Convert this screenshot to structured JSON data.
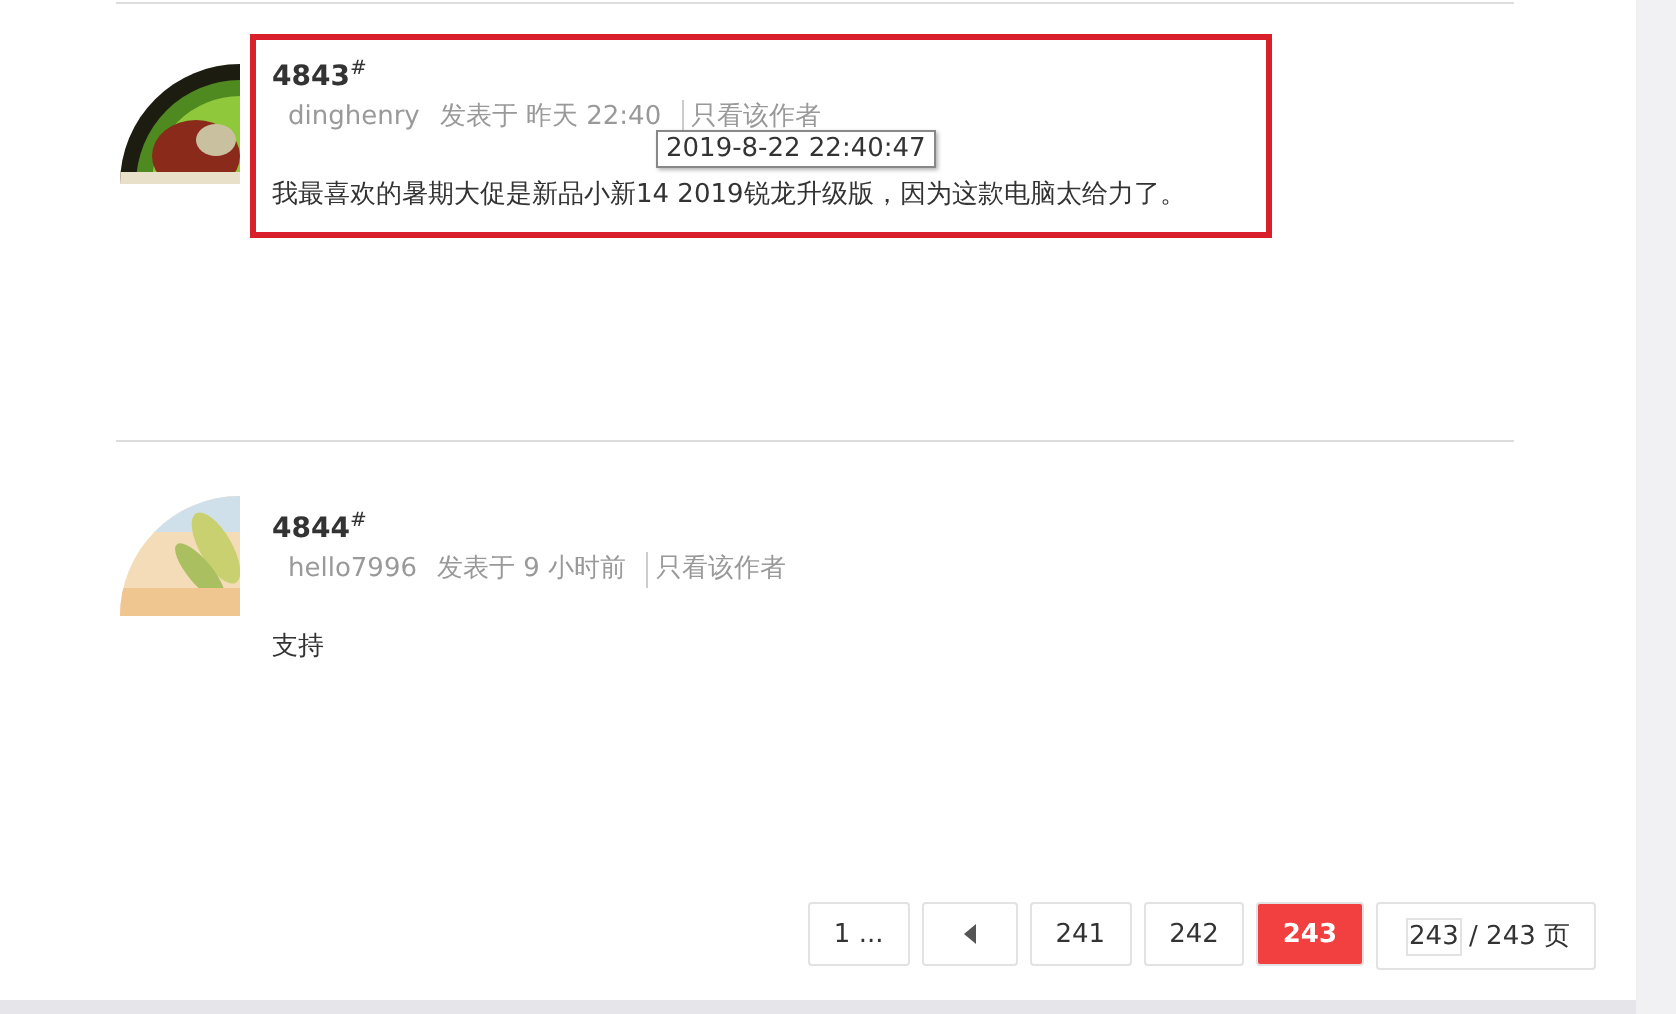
{
  "posts": [
    {
      "floor": "4843",
      "floor_mark": "#",
      "author": "dinghenry",
      "posted": "发表于 昨天 22:40",
      "author_only": "只看该作者",
      "body": "我最喜欢的暑期大促是新品小新14 2019锐龙升级版，因为这款电脑太给力了。",
      "highlighted": true,
      "tooltip": "2019-8-22 22:40:47"
    },
    {
      "floor": "4844",
      "floor_mark": "#",
      "author": "hello7996",
      "posted": "发表于 9 小时前",
      "author_only": "只看该作者",
      "body": "支持",
      "highlighted": false
    }
  ],
  "pagination": {
    "first": "1 ...",
    "pages": [
      {
        "label": "241",
        "selected": false
      },
      {
        "label": "242",
        "selected": false
      },
      {
        "label": "243",
        "selected": true
      }
    ],
    "page_input": "243",
    "total": "/ 243 页"
  }
}
